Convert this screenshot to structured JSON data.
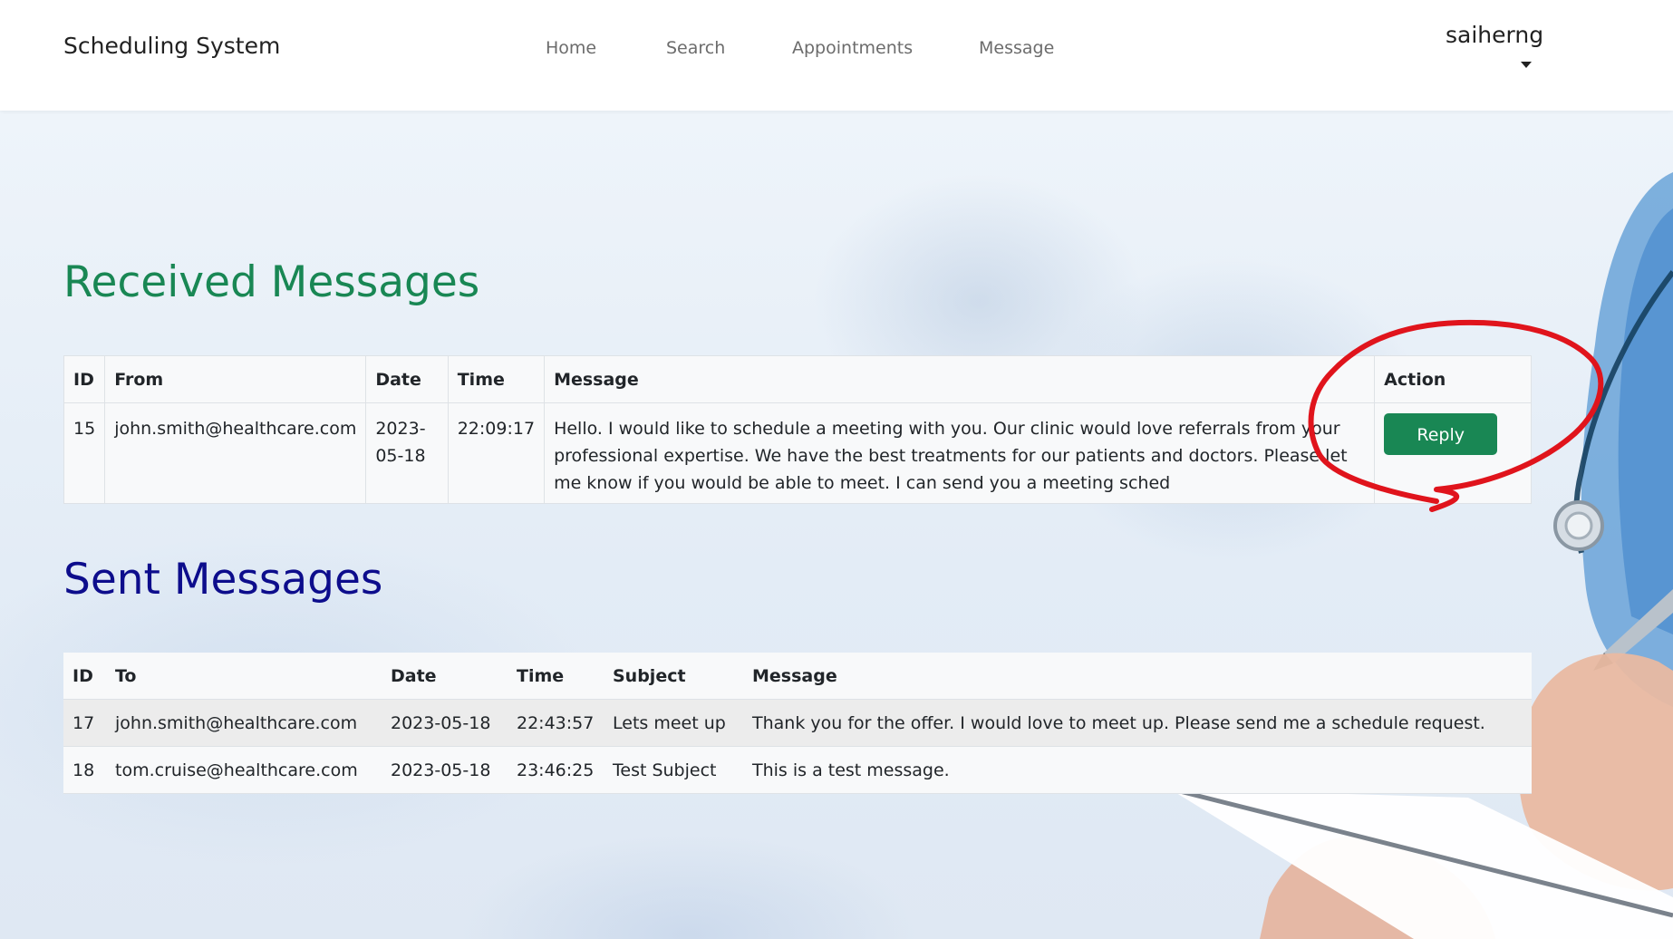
{
  "navbar": {
    "brand": "Scheduling System",
    "links": [
      "Home",
      "Search",
      "Appointments",
      "Message"
    ],
    "user": "saiherng"
  },
  "received": {
    "heading": "Received Messages",
    "columns": [
      "ID",
      "From",
      "Date",
      "Time",
      "Message",
      "Action"
    ],
    "rows": [
      {
        "id": "15",
        "from": "john.smith@healthcare.com",
        "date": "2023-05-18",
        "time": "22:09:17",
        "message": "Hello. I would like to schedule a meeting with you. Our clinic would love referrals from your professional expertise. We have the best treatments for our patients and doctors. Please let me know if you would be able to meet. I can send you a meeting sched",
        "action": "Reply"
      }
    ]
  },
  "sent": {
    "heading": "Sent Messages",
    "columns": [
      "ID",
      "To",
      "Date",
      "Time",
      "Subject",
      "Message"
    ],
    "rows": [
      {
        "id": "17",
        "to": "john.smith@healthcare.com",
        "date": "2023-05-18",
        "time": "22:43:57",
        "subject": "Lets meet up",
        "message": "Thank you for the offer. I would love to meet up. Please send me a schedule request."
      },
      {
        "id": "18",
        "to": "tom.cruise@healthcare.com",
        "date": "2023-05-18",
        "time": "23:46:25",
        "subject": "Test Subject",
        "message": "This is a test message."
      }
    ]
  },
  "colors": {
    "received_heading": "#198754",
    "sent_heading": "#0d0d8c",
    "reply_button": "#198754",
    "annotation_circle": "#e0141c"
  },
  "icons": {
    "user_menu": "caret-down-icon"
  }
}
